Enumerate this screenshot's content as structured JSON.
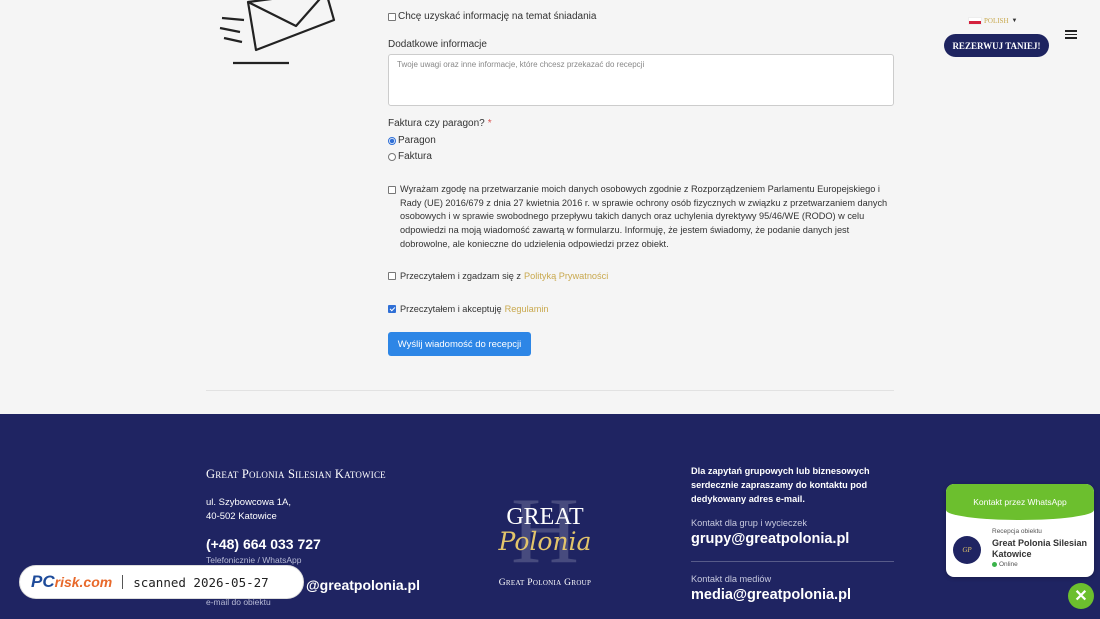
{
  "header": {
    "language": "POLISH",
    "book_button": "REZERWUJ TANIEJ!"
  },
  "form": {
    "breakfast_info": "Chcę uzyskać informację na temat śniadania",
    "extra_info_label": "Dodatkowe informacje",
    "extra_info_placeholder": "Twoje uwagi oraz inne informacje, które chcesz przekazać do recepcji",
    "invoice_label": "Faktura czy paragon?",
    "required_mark": "*",
    "option_receipt": "Paragon",
    "option_invoice": "Faktura",
    "consent_text": "Wyrażam zgodę na przetwarzanie moich danych osobowych zgodnie z Rozporządzeniem Parlamentu Europejskiego i Rady (UE) 2016/679 z dnia 27 kwietnia 2016 r. w sprawie ochrony osób fizycznych w związku z przetwarzaniem danych osobowych i w sprawie swobodnego przepływu takich danych oraz uchylenia dyrektywy 95/46/WE (RODO) w celu odpowiedzi na moją wiadomość zawartą w formularzu. Informuję, że jestem świadomy, że podanie danych jest dobrowolne, ale konieczne do udzielenia odpowiedzi przez obiekt.",
    "privacy_prefix": "Przeczytałem i zgadzam się z",
    "privacy_link": "Polityką Prywatności",
    "terms_prefix": "Przeczytałem i akceptuję",
    "terms_link": "Regulamin",
    "send_button": "Wyślij wiadomość do recepcji"
  },
  "footer": {
    "hotel_name": "Great Polonia Silesian Katowice",
    "address_line1": "ul. Szybowcowa 1A,",
    "address_line2": "40-502 Katowice",
    "phone": "(+48) 664 033 727",
    "phone_sub": "Telefonicznie / WhatsApp",
    "email_partial": "@greatpolonia.pl",
    "email_sub": "e-mail do obiektu",
    "logo_letter": "H",
    "logo_great": "GREAT",
    "logo_polonia": "Polonia",
    "logo_group": "Great Polonia Group",
    "group_intro": "Dla zapytań grupowych lub biznesowych serdecznie zapraszamy do kontaktu pod dedykowany adres e-mail.",
    "groups_label": "Kontakt dla grup i wycieczek",
    "groups_email": "grupy@greatpolonia.pl",
    "media_label": "Kontakt dla mediów",
    "media_email": "media@greatpolonia.pl"
  },
  "whatsapp": {
    "header": "Kontakt przez WhatsApp",
    "small": "Recepcja obiektu",
    "name": "Great Polonia Silesian Katowice",
    "status": "Online",
    "close": "✕"
  },
  "watermark": {
    "logo_pc": "PC",
    "logo_risk": "risk.com",
    "text": "scanned 2026-05-27"
  },
  "colors": {
    "footer_bg": "#1f2462",
    "accent_gold": "#c9a94f",
    "button_blue": "#2d86e6",
    "whatsapp_green": "#6cbf2e"
  }
}
